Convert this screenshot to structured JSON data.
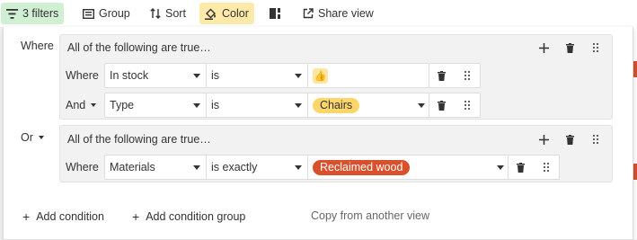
{
  "toolbar": {
    "filters_label": "3 filters",
    "group_label": "Group",
    "sort_label": "Sort",
    "color_label": "Color",
    "share_label": "Share view"
  },
  "filters": {
    "root_conjunction": "Where",
    "groups": [
      {
        "conjunction": "Where",
        "title": "All of the following are true…",
        "conditions": [
          {
            "conjunction": "Where",
            "field": "In stock",
            "operator": "is",
            "value_icon": "thumbs-up-icon"
          },
          {
            "conjunction": "And",
            "field": "Type",
            "operator": "is",
            "value": "Chairs",
            "value_color": "#fdd66b"
          }
        ]
      },
      {
        "conjunction": "Or",
        "title": "All of the following are true…",
        "conditions": [
          {
            "conjunction": "Where",
            "field": "Materials",
            "operator": "is exactly",
            "value": "Reclaimed wood",
            "value_color": "#d9512c"
          }
        ]
      }
    ]
  },
  "footer": {
    "add_condition": "Add condition",
    "add_condition_group": "Add condition group",
    "copy_from_view": "Copy from another view"
  },
  "colors": {
    "filters_active": "#d1f0d3",
    "color_active": "#fde9a8",
    "accent_red": "#d9512c"
  }
}
